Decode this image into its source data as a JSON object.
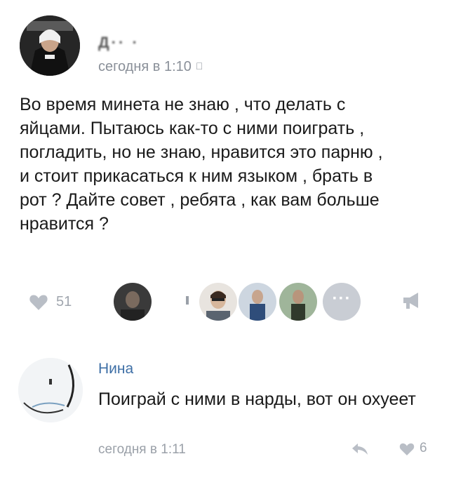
{
  "post": {
    "author_name": "Д·· ·",
    "time": "сегодня в 1:10",
    "time_icon": "apple-icon",
    "text": "Во время минета не знаю , что делать с\nяйцами. Пытаюсь как-то с ними поиграть ,\nпогладить, но не знаю, нравится это парню ,\nи стоит прикасаться к ним языком , брать в\nрот ? Дайте совет , ребята , как вам больше\nнравится ?",
    "like_count": "51",
    "more_likers_label": "···"
  },
  "comment": {
    "author": "Нина",
    "text": "Поиграй с ними в нарды, вот он охуеет",
    "time": "сегодня в 1:11",
    "like_count": "6"
  },
  "colors": {
    "meta_gray": "#8a9099",
    "link_blue": "#3e6fa6",
    "icon_gray": "#a0a6ae"
  }
}
